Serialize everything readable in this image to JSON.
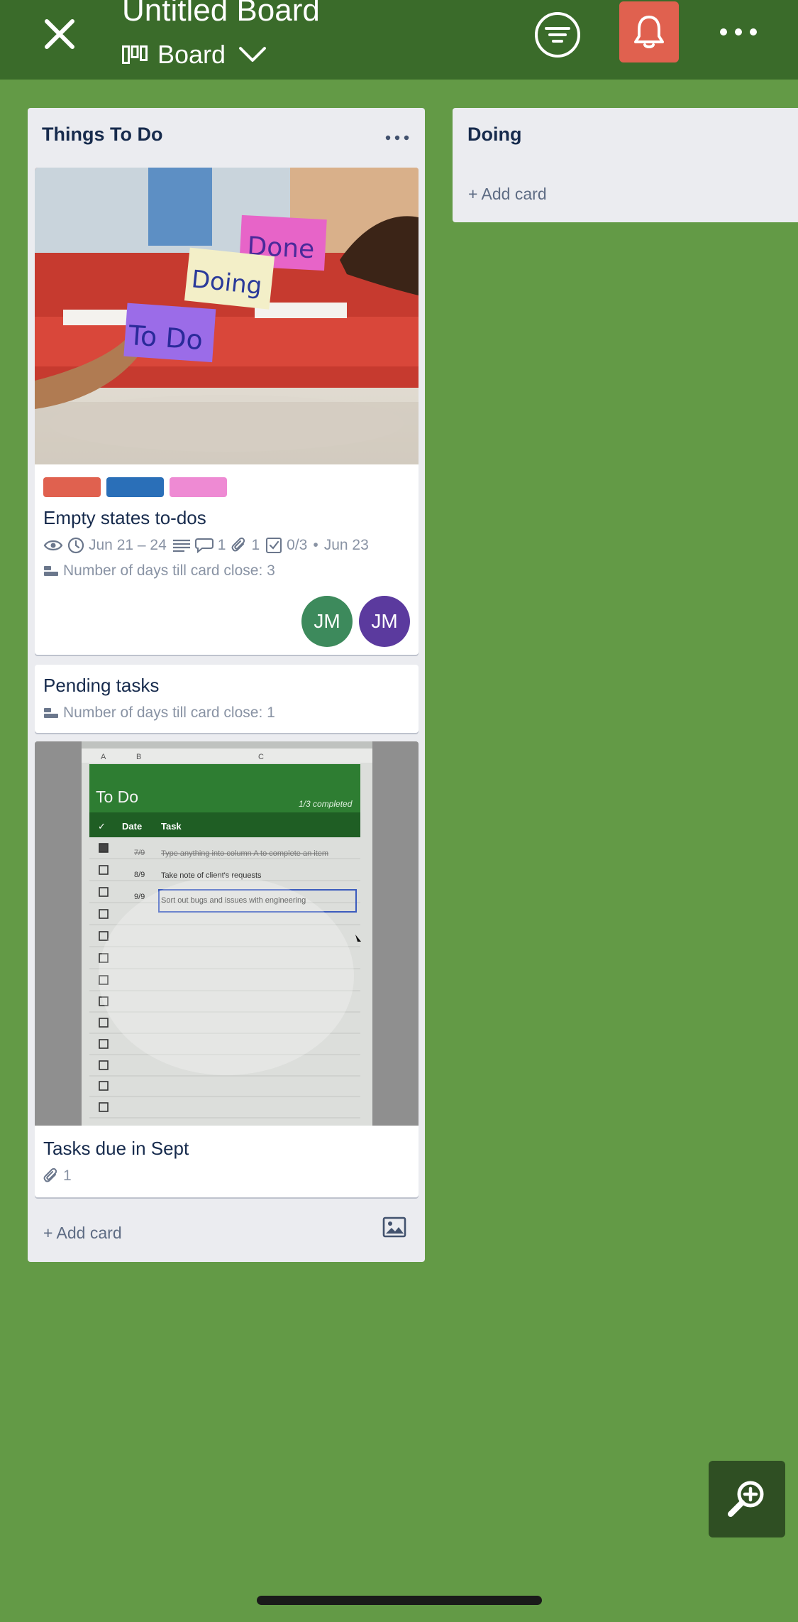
{
  "header": {
    "board_title": "Untitled Board",
    "view_label": "Board"
  },
  "colors": {
    "background": "#639a46",
    "header": "#3a6b2a",
    "bell_button": "#e0614f",
    "label_red": "#e0614f",
    "label_blue": "#2a6fb8",
    "label_pink": "#ee8ad3",
    "avatar_green": "#3d8a5c",
    "avatar_purple": "#5b3a9e"
  },
  "lists": [
    {
      "title": "Things To Do",
      "add_card": "+ Add card",
      "cards": [
        {
          "cover_notes": [
            "Done",
            "Doing",
            "To Do"
          ],
          "title": "Empty states to-dos",
          "dates": "Jun 21 – 24",
          "comments": "1",
          "attachments": "1",
          "checklist": "0/3",
          "due_separator": "•",
          "due": "Jun 23",
          "custom_field": "Number of days till card close: 3",
          "members": [
            "JM",
            "JM"
          ]
        },
        {
          "title": "Pending tasks",
          "custom_field": "Number of days till card close: 1"
        },
        {
          "cover_sheet": {
            "columns": [
              "A",
              "B",
              "C"
            ],
            "heading": "To Do",
            "progress": "1/3 completed",
            "header_date": "Date",
            "header_task": "Task",
            "rows": [
              {
                "date": "7/9",
                "task": "Type anything into column A to complete an item",
                "done": true
              },
              {
                "date": "8/9",
                "task": "Take note of client's requests",
                "done": false
              },
              {
                "date": "9/9",
                "task": "Sort out bugs and issues with engineering",
                "done": false
              }
            ]
          },
          "title": "Tasks due in Sept",
          "attachments": "1"
        }
      ]
    },
    {
      "title": "Doing",
      "add_card": "+ Add card"
    }
  ]
}
